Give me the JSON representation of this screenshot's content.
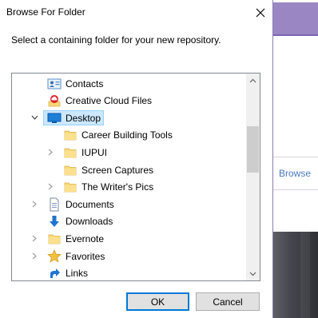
{
  "dialog": {
    "title": "Browse For Folder",
    "instruction": "Select a containing folder for your new repository.",
    "ok_label": "OK",
    "cancel_label": "Cancel"
  },
  "tree": {
    "items": [
      {
        "label": "Contacts",
        "icon": "contacts-icon",
        "expandable": false,
        "expanded": false,
        "selected": false,
        "level": 1
      },
      {
        "label": "Creative Cloud Files",
        "icon": "creative-cloud-icon",
        "expandable": false,
        "expanded": false,
        "selected": false,
        "level": 1
      },
      {
        "label": "Desktop",
        "icon": "desktop-icon",
        "expandable": true,
        "expanded": true,
        "selected": true,
        "level": 1
      },
      {
        "label": "Career Building Tools",
        "icon": "folder-icon",
        "expandable": false,
        "expanded": false,
        "selected": false,
        "level": 2
      },
      {
        "label": "IUPUI",
        "icon": "folder-icon",
        "expandable": true,
        "expanded": false,
        "selected": false,
        "level": 2
      },
      {
        "label": "Screen Captures",
        "icon": "folder-icon",
        "expandable": false,
        "expanded": false,
        "selected": false,
        "level": 2
      },
      {
        "label": "The Writer's Pics",
        "icon": "folder-icon",
        "expandable": true,
        "expanded": false,
        "selected": false,
        "level": 2
      },
      {
        "label": "Documents",
        "icon": "documents-icon",
        "expandable": true,
        "expanded": false,
        "selected": false,
        "level": 1
      },
      {
        "label": "Downloads",
        "icon": "downloads-icon",
        "expandable": false,
        "expanded": false,
        "selected": false,
        "level": 1
      },
      {
        "label": "Evernote",
        "icon": "folder-icon",
        "expandable": true,
        "expanded": false,
        "selected": false,
        "level": 1
      },
      {
        "label": "Favorites",
        "icon": "favorites-icon",
        "expandable": true,
        "expanded": false,
        "selected": false,
        "level": 1
      },
      {
        "label": "Links",
        "icon": "links-icon",
        "expandable": false,
        "expanded": false,
        "selected": false,
        "level": 1
      }
    ]
  },
  "background_app": {
    "browse_label": "Browse"
  },
  "colors": {
    "selection_bg": "#cce8ff",
    "accent": "#0078d7",
    "folder": "#f8d775",
    "purple_accent": "#7c64b3"
  }
}
